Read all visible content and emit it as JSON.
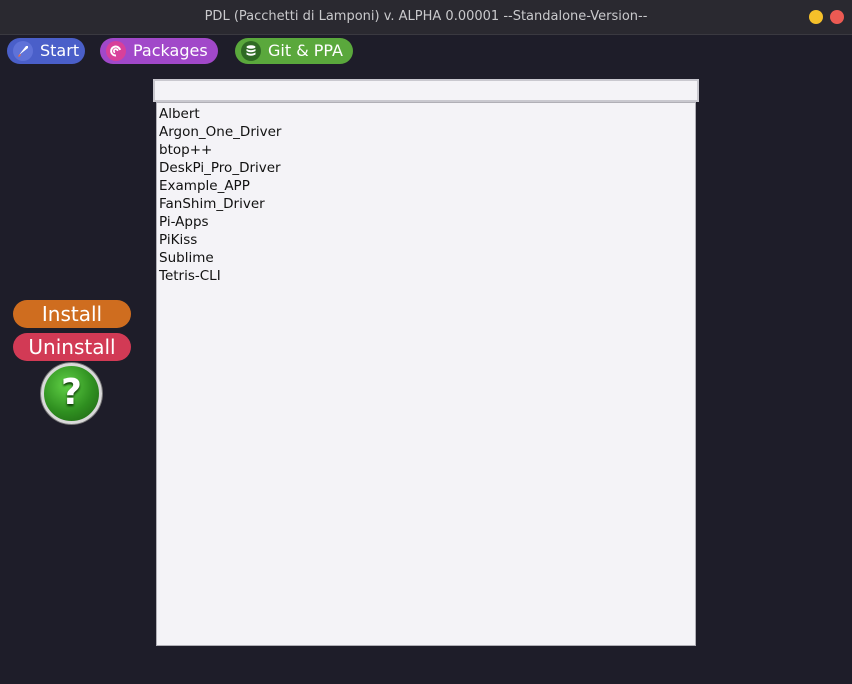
{
  "window": {
    "title": "PDL (Pacchetti di Lamponi) v. ALPHA 0.00001 --Standalone-Version--",
    "controls": [
      "minimize",
      "close"
    ],
    "colors": {
      "minimize": "#f5c02a",
      "close": "#ec5a53"
    }
  },
  "tabs": [
    {
      "label": "Start",
      "icon": "rocket-icon",
      "color": "#4a5fc9"
    },
    {
      "label": "Packages",
      "icon": "debian-swirl-icon",
      "color": "#a148c9"
    },
    {
      "label": "Git & PPA",
      "icon": "database-icon",
      "color": "#5aa83c"
    }
  ],
  "search": {
    "value": "",
    "placeholder": ""
  },
  "packages": [
    "Albert",
    "Argon_One_Driver",
    "btop++",
    "DeskPi_Pro_Driver",
    "Example_APP",
    "FanShim_Driver",
    "Pi-Apps",
    "PiKiss",
    "Sublime",
    "Tetris-CLI"
  ],
  "actions": {
    "install_label": "Install",
    "install_color": "#cf6d1f",
    "uninstall_label": "Uninstall",
    "uninstall_color": "#d23a55",
    "help_symbol": "?",
    "help_icon": "help-question-icon"
  }
}
